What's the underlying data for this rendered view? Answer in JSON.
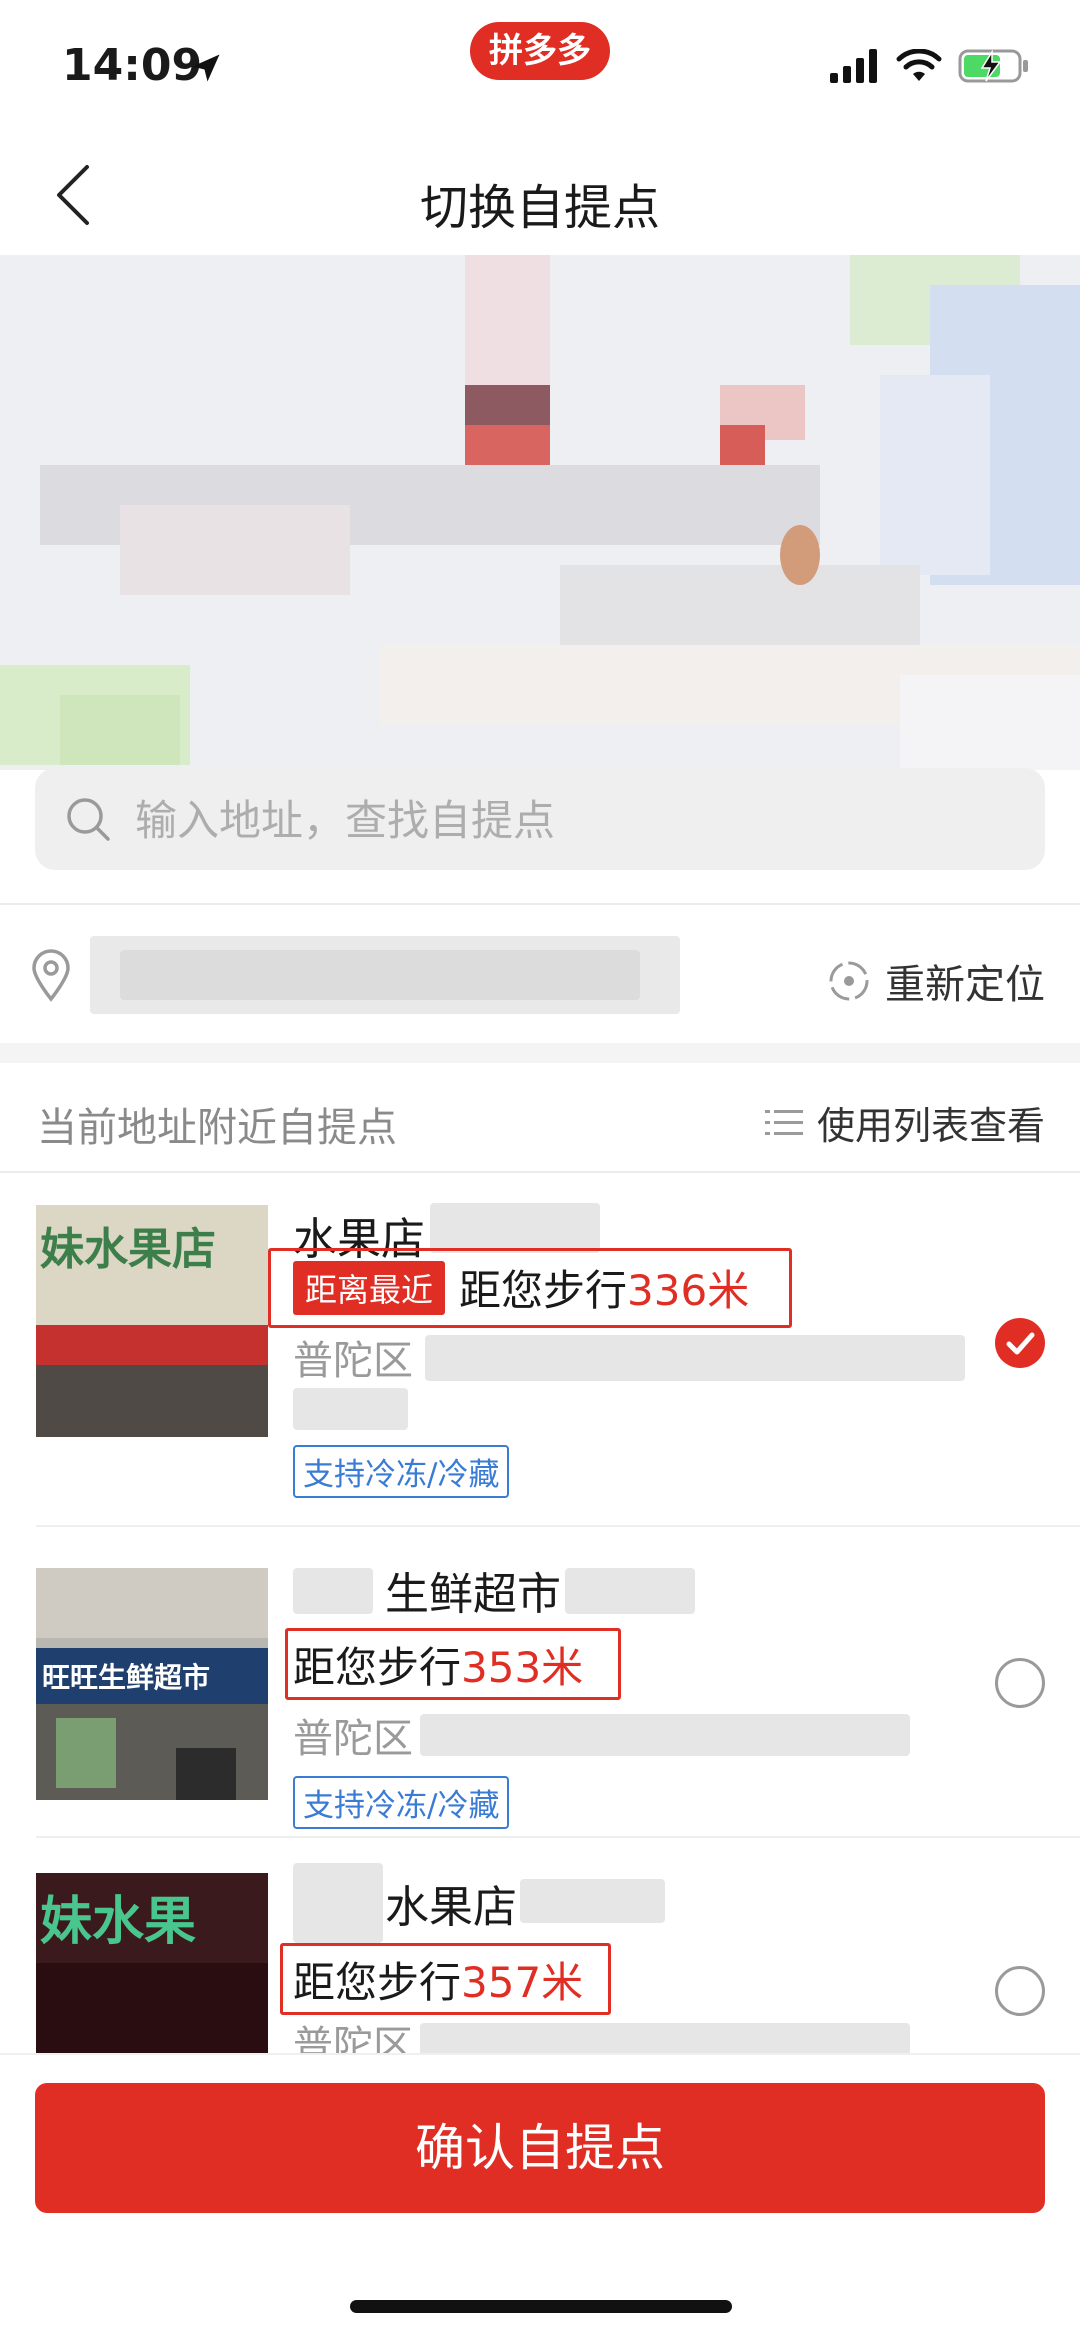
{
  "status_bar": {
    "time": "14:09",
    "app_badge": "拼多多"
  },
  "header": {
    "title": "切换自提点"
  },
  "search": {
    "placeholder": "输入地址，查找自提点"
  },
  "location": {
    "relocate_label": "重新定位"
  },
  "section": {
    "title": "当前地址附近自提点",
    "list_view_label": "使用列表查看"
  },
  "stores": [
    {
      "name": "水果店",
      "nearest_tag": "距离最近",
      "distance_prefix": "距您步行",
      "distance_value": "336米",
      "address": "普陀区",
      "tag": "支持冷冻/冷藏",
      "selected": true
    },
    {
      "name": "生鲜超市",
      "distance_prefix": "距您步行",
      "distance_value": "353米",
      "address": "普陀区",
      "tag": "支持冷冻/冷藏",
      "selected": false
    },
    {
      "name": "水果店",
      "distance_prefix": "距您步行",
      "distance_value": "357米",
      "address": "普陀区",
      "selected": false
    }
  ],
  "photo_text": {
    "store1": "妹水果店",
    "store2": "旺旺生鲜超市",
    "store3": "妹水果"
  },
  "footer": {
    "confirm_label": "确认自提点"
  },
  "colors": {
    "brand_red": "#e02e24",
    "tag_blue": "#3a7bd5",
    "muted_text": "#9a9a9a"
  }
}
